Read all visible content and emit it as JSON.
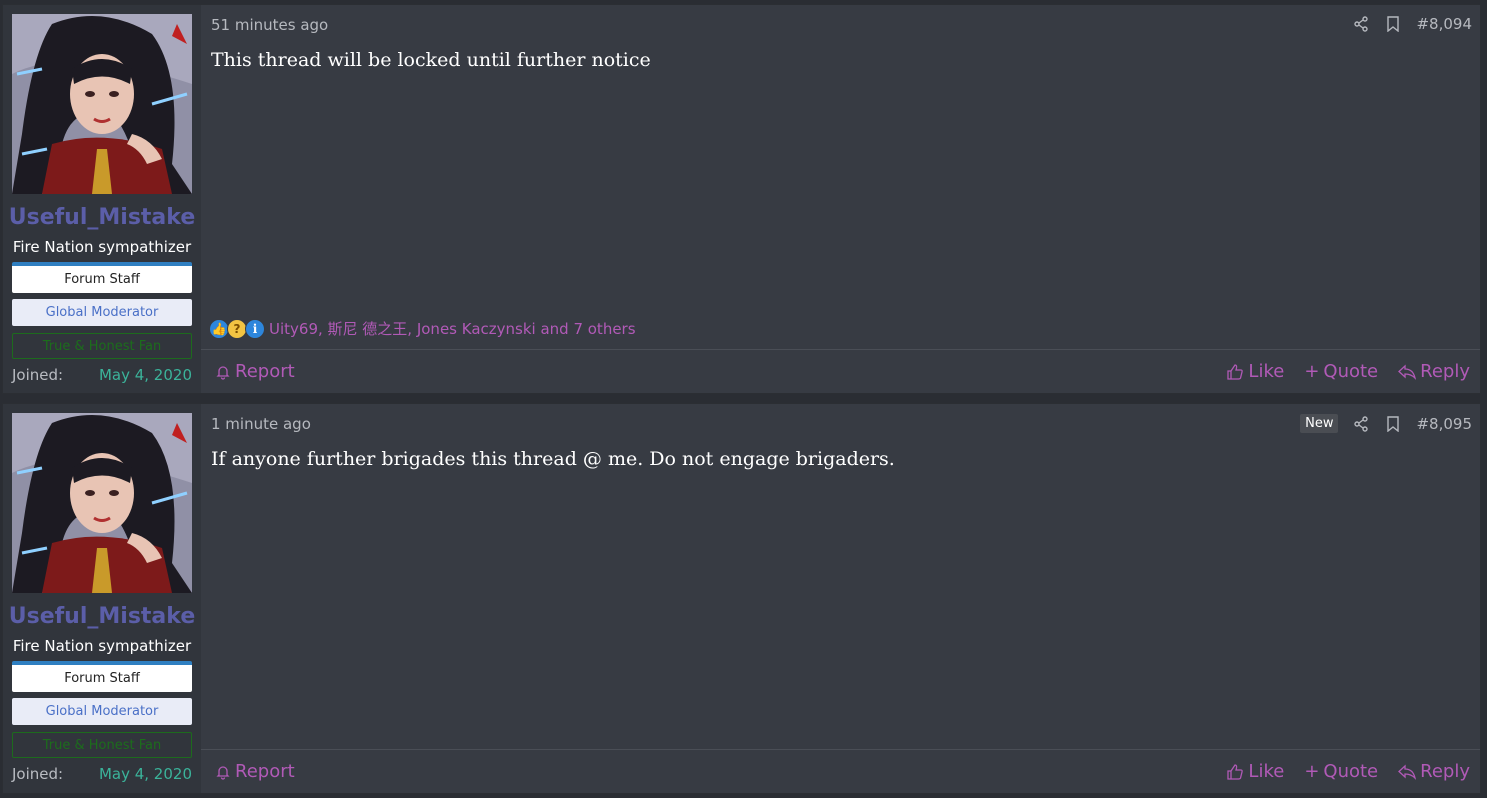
{
  "posts": [
    {
      "author": {
        "username": "Useful_Mistake",
        "user_title": "Fire Nation sympathizer",
        "banners": [
          "Forum Staff",
          "Global Moderator",
          "True & Honest Fan"
        ],
        "joined_label": "Joined:",
        "joined_date": "May 4, 2020"
      },
      "timestamp": "51 minutes ago",
      "new_badge": "",
      "post_number": "#8,094",
      "body": "This thread will be locked until further notice",
      "reactions": {
        "icons": [
          "like-icon",
          "thinking-icon",
          "info-icon"
        ],
        "text": "Uity69, 斯尼 德之王, Jones Kaczynski and 7 others"
      },
      "actions": {
        "report": "Report",
        "like": "Like",
        "quote": "Quote",
        "reply": "Reply"
      }
    },
    {
      "author": {
        "username": "Useful_Mistake",
        "user_title": "Fire Nation sympathizer",
        "banners": [
          "Forum Staff",
          "Global Moderator",
          "True & Honest Fan"
        ],
        "joined_label": "Joined:",
        "joined_date": "May 4, 2020"
      },
      "timestamp": "1 minute ago",
      "new_badge": "New",
      "post_number": "#8,095",
      "body": "If anyone further brigades this thread @ me. Do not engage brigaders.",
      "actions": {
        "report": "Report",
        "like": "Like",
        "quote": "Quote",
        "reply": "Reply"
      }
    }
  ],
  "colors": {
    "username": "#5b5ea8",
    "joined_date": "#3bb39a",
    "action_link": "#b15ab7",
    "post_bg": "#373b43",
    "sidebar_bg": "#31353c"
  }
}
